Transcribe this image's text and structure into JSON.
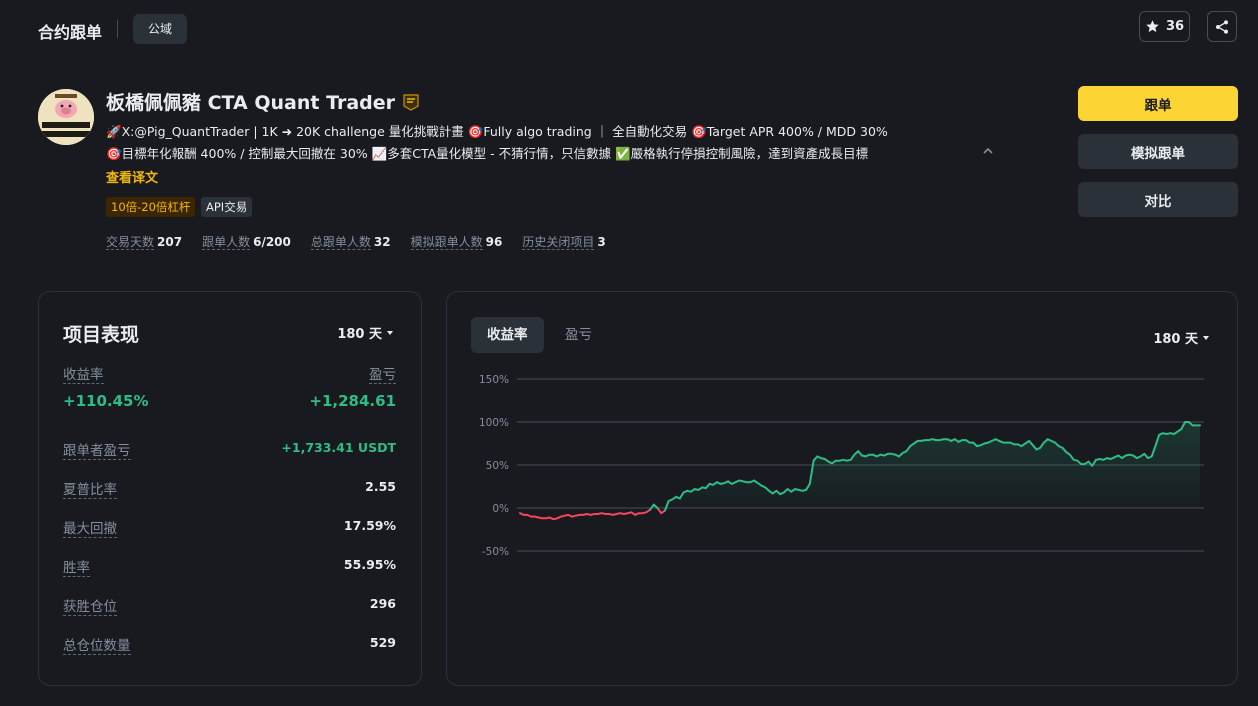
{
  "header": {
    "title": "合约跟单",
    "domain_tab": "公域",
    "favorite_count": "36"
  },
  "profile": {
    "name": "板橋佩佩豬 CTA Quant Trader",
    "bio_line1": "🚀X:@Pig_QuantTrader | 1K ➜ 20K challenge 量化挑戰計畫 🎯Fully algo trading ｜ 全自動化交易 🎯Target APR 400% / MDD 30%",
    "bio_line2": "🎯目標年化報酬 400% / 控制最大回撤在 30% 📈多套CTA量化模型 - 不猜行情，只信數據 ✅嚴格執行停損控制風險，達到資產成長目標",
    "translate_link": "查看译文",
    "tags": [
      "10倍-20倍杠杆",
      "API交易"
    ],
    "stats": [
      {
        "label": "交易天数",
        "value": "207"
      },
      {
        "label": "跟单人数",
        "value": "6/200"
      },
      {
        "label": "总跟单人数",
        "value": "32"
      },
      {
        "label": "模拟跟单人数",
        "value": "96"
      },
      {
        "label": "历史关闭项目",
        "value": "3"
      }
    ]
  },
  "actions": {
    "follow": "跟单",
    "mock_follow": "模拟跟单",
    "compare": "对比"
  },
  "performance": {
    "title": "项目表现",
    "period": "180 天",
    "roi_label": "收益率",
    "roi_value": "+110.45%",
    "pnl_label": "盈亏",
    "pnl_value": "+1,284.61",
    "rows": [
      {
        "label": "跟单者盈亏",
        "value": "+1,733.41 USDT"
      },
      {
        "label": "夏普比率",
        "value": "2.55"
      },
      {
        "label": "最大回撤",
        "value": "17.59%"
      },
      {
        "label": "胜率",
        "value": "55.95%"
      },
      {
        "label": "获胜仓位",
        "value": "296"
      },
      {
        "label": "总仓位数量",
        "value": "529"
      }
    ]
  },
  "chart_panel": {
    "tabs": [
      "收益率",
      "盈亏"
    ],
    "period": "180 天"
  },
  "colors": {
    "accent": "#fcd535",
    "positive": "#2ebd85",
    "negative": "#f6465d",
    "background": "#181a20",
    "surface": "#2b3139"
  },
  "chart_data": {
    "type": "line",
    "ylabel": "",
    "xlabel": "",
    "y_ticks": [
      "150%",
      "100%",
      "50%",
      "0%",
      "-50%"
    ],
    "y_tick_values": [
      150,
      100,
      50,
      0,
      -50
    ],
    "ylim": [
      -50,
      150
    ],
    "grid": true,
    "fill": "area",
    "series": [
      {
        "values": [
          -6,
          -8,
          -8,
          -10,
          -10,
          -11,
          -12,
          -12,
          -11,
          -13,
          -12,
          -10,
          -9,
          -8,
          -10,
          -9,
          -8,
          -8,
          -7,
          -8,
          -7,
          -7,
          -6,
          -7,
          -7,
          -8,
          -7,
          -6,
          -7,
          -6,
          -5,
          -8,
          -6,
          -6,
          -5,
          -2,
          4,
          0,
          -6,
          -3,
          8,
          10,
          13,
          11,
          18,
          20,
          19,
          22,
          21,
          24,
          23,
          28,
          27,
          30,
          28,
          29,
          31,
          28,
          30,
          32,
          31,
          30,
          30,
          32,
          29,
          26,
          24,
          20,
          17,
          20,
          16,
          18,
          22,
          19,
          22,
          21,
          20,
          21,
          28,
          55,
          60,
          58,
          57,
          54,
          52,
          55,
          55,
          56,
          55,
          56,
          62,
          66,
          61,
          60,
          62,
          62,
          60,
          62,
          61,
          63,
          63,
          62,
          60,
          64,
          66,
          72,
          75,
          78,
          78,
          79,
          79,
          80,
          79,
          79,
          80,
          80,
          78,
          80,
          77,
          79,
          79,
          76,
          76,
          72,
          73,
          75,
          76,
          78,
          80,
          78,
          76,
          76,
          76,
          74,
          74,
          72,
          75,
          78,
          73,
          68,
          70,
          76,
          80,
          78,
          76,
          72,
          70,
          65,
          62,
          56,
          55,
          51,
          51,
          54,
          49,
          56,
          57,
          56,
          58,
          57,
          59,
          61,
          58,
          61,
          62,
          61,
          58,
          60,
          63,
          58,
          60,
          72,
          85,
          87,
          86,
          87,
          86,
          89,
          92,
          100,
          100,
          96,
          96,
          96
        ]
      }
    ]
  }
}
